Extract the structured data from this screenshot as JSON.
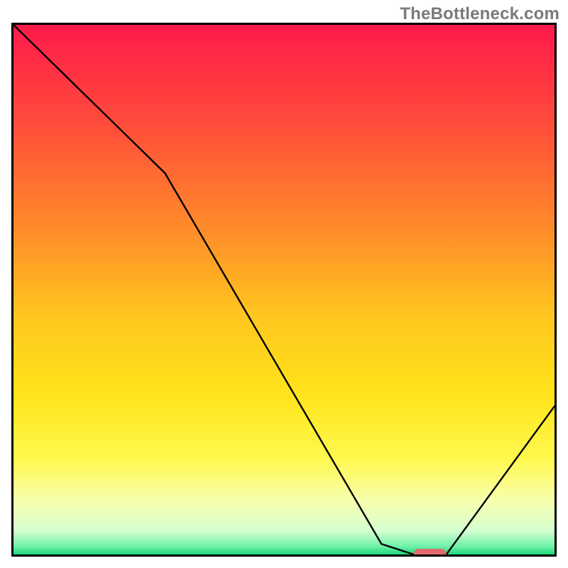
{
  "watermark": "TheBottleneck.com",
  "chart_data": {
    "type": "line",
    "title": "",
    "xlabel": "",
    "ylabel": "",
    "xlim": [
      0,
      100
    ],
    "ylim": [
      0,
      100
    ],
    "series": [
      {
        "name": "curve",
        "x": [
          0,
          12,
          28,
          68,
          74,
          80,
          100
        ],
        "y": [
          100,
          88,
          72,
          2,
          0,
          0,
          28
        ]
      }
    ],
    "marker": {
      "x_start": 74,
      "x_end": 80,
      "y": 0,
      "color": "#e16a6f"
    },
    "gradient_stops": [
      {
        "offset": 0.0,
        "color": "#ff1a4b"
      },
      {
        "offset": 0.18,
        "color": "#ff4a3b"
      },
      {
        "offset": 0.38,
        "color": "#ff8a2a"
      },
      {
        "offset": 0.55,
        "color": "#ffc61f"
      },
      {
        "offset": 0.7,
        "color": "#ffe41a"
      },
      {
        "offset": 0.82,
        "color": "#fff94f"
      },
      {
        "offset": 0.9,
        "color": "#f7ffb0"
      },
      {
        "offset": 0.955,
        "color": "#d6ffd0"
      },
      {
        "offset": 0.985,
        "color": "#6ef0a8"
      },
      {
        "offset": 1.0,
        "color": "#19d77a"
      }
    ]
  }
}
